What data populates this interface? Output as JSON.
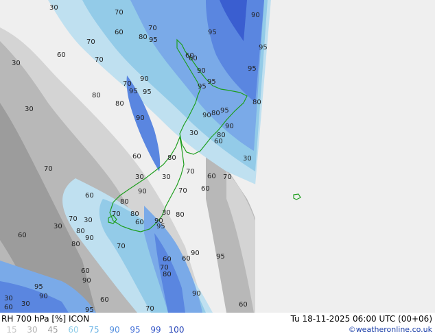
{
  "map": {
    "colors": {
      "background": "#efefef",
      "gray_light": "#d4d4d4",
      "gray_mid": "#b8b8b8",
      "gray_dark": "#9c9c9c",
      "blue_60": "#bfe0f0",
      "blue_75": "#93cbe8",
      "blue_90": "#7aaae8",
      "blue_95": "#5a86e0",
      "blue_99": "#3a5ed0",
      "coastline": "#1e9e1e",
      "label": "#222222"
    },
    "contour_labels": [
      {
        "id": "l1",
        "text": "30"
      },
      {
        "id": "l2",
        "text": "70"
      },
      {
        "id": "l3",
        "text": "70"
      },
      {
        "id": "l4",
        "text": "60"
      },
      {
        "id": "l5",
        "text": "80"
      },
      {
        "id": "l6",
        "text": "95"
      },
      {
        "id": "l7",
        "text": "95"
      },
      {
        "id": "l8",
        "text": "90"
      },
      {
        "id": "l9",
        "text": "95"
      },
      {
        "id": "l10",
        "text": "60"
      },
      {
        "id": "l11",
        "text": "70"
      },
      {
        "id": "l12",
        "text": "60"
      },
      {
        "id": "l13",
        "text": "30"
      },
      {
        "id": "l14",
        "text": "70"
      },
      {
        "id": "l15",
        "text": "60"
      },
      {
        "id": "l16",
        "text": "90"
      },
      {
        "id": "l17",
        "text": "95"
      },
      {
        "id": "l18",
        "text": "70"
      },
      {
        "id": "l19",
        "text": "90"
      },
      {
        "id": "l20",
        "text": "95"
      },
      {
        "id": "l21",
        "text": "95"
      },
      {
        "id": "l22",
        "text": "95"
      },
      {
        "id": "l23",
        "text": "95"
      },
      {
        "id": "l24",
        "text": "80"
      },
      {
        "id": "l25",
        "text": "80"
      },
      {
        "id": "l26",
        "text": "30"
      },
      {
        "id": "l27",
        "text": "90"
      },
      {
        "id": "l28",
        "text": "95"
      },
      {
        "id": "l29",
        "text": "80"
      },
      {
        "id": "l30",
        "text": "90"
      },
      {
        "id": "l31",
        "text": "80"
      },
      {
        "id": "l32",
        "text": "30"
      },
      {
        "id": "l33",
        "text": "80"
      },
      {
        "id": "l34",
        "text": "90"
      },
      {
        "id": "l35",
        "text": "60"
      },
      {
        "id": "l36",
        "text": "30"
      },
      {
        "id": "l37",
        "text": "80"
      },
      {
        "id": "l38",
        "text": "60"
      },
      {
        "id": "l39",
        "text": "70"
      },
      {
        "id": "l40",
        "text": "30"
      },
      {
        "id": "l41",
        "text": "30"
      },
      {
        "id": "l42",
        "text": "70"
      },
      {
        "id": "l43",
        "text": "60"
      },
      {
        "id": "l44",
        "text": "70"
      },
      {
        "id": "l45",
        "text": "90"
      },
      {
        "id": "l46",
        "text": "70"
      },
      {
        "id": "l47",
        "text": "60"
      },
      {
        "id": "l48",
        "text": "60"
      },
      {
        "id": "l49",
        "text": "80"
      },
      {
        "id": "l50",
        "text": "70"
      },
      {
        "id": "l51",
        "text": "80"
      },
      {
        "id": "l52",
        "text": "70"
      },
      {
        "id": "l53",
        "text": "30"
      },
      {
        "id": "l54",
        "text": "80"
      },
      {
        "id": "l55",
        "text": "30"
      },
      {
        "id": "l56",
        "text": "60"
      },
      {
        "id": "l57",
        "text": "90"
      },
      {
        "id": "l58",
        "text": "30"
      },
      {
        "id": "l59",
        "text": "80"
      },
      {
        "id": "l60",
        "text": "95"
      },
      {
        "id": "l61",
        "text": "60"
      },
      {
        "id": "l62",
        "text": "90"
      },
      {
        "id": "l63",
        "text": "80"
      },
      {
        "id": "l64",
        "text": "70"
      },
      {
        "id": "l65",
        "text": "90"
      },
      {
        "id": "l66",
        "text": "60"
      },
      {
        "id": "l67",
        "text": "95"
      },
      {
        "id": "l68",
        "text": "60"
      },
      {
        "id": "l69",
        "text": "70"
      },
      {
        "id": "l70",
        "text": "80"
      },
      {
        "id": "l71",
        "text": "60"
      },
      {
        "id": "l72",
        "text": "90"
      },
      {
        "id": "l73",
        "text": "95"
      },
      {
        "id": "l74",
        "text": "90"
      },
      {
        "id": "l75",
        "text": "30"
      },
      {
        "id": "l76",
        "text": "60"
      },
      {
        "id": "l77",
        "text": "90"
      }
    ]
  },
  "footer": {
    "title": "RH 700 hPa [%] ICON",
    "datetime": "Tu 18-11-2025 06:00 UTC (00+06)",
    "credit": "©weatheronline.co.uk",
    "legend": [
      {
        "text": "15",
        "color": "#c8c8c8"
      },
      {
        "text": "30",
        "color": "#b4b4b4"
      },
      {
        "text": "45",
        "color": "#a0a0a0"
      },
      {
        "text": "60",
        "color": "#8fcde8"
      },
      {
        "text": "75",
        "color": "#6cb4e6"
      },
      {
        "text": "90",
        "color": "#5590e0"
      },
      {
        "text": "95",
        "color": "#4470d8"
      },
      {
        "text": "99",
        "color": "#3456c8"
      },
      {
        "text": "100",
        "color": "#2846b8"
      }
    ]
  }
}
